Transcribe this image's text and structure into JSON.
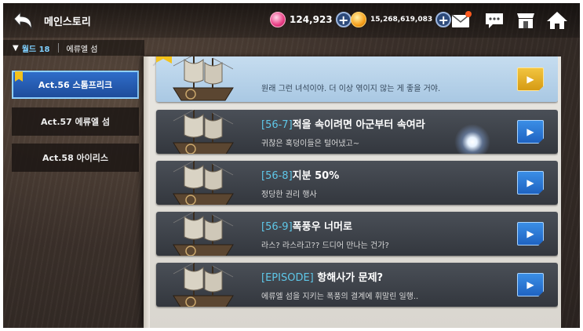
{
  "header": {
    "title": "메인스토리",
    "currency_gem": "124,923",
    "currency_gold": "15,268,619,083"
  },
  "breadcrumb": {
    "world": "월드 18",
    "island": "에류엘 섬"
  },
  "acts": [
    {
      "label": "Act.56 스톰프리크",
      "selected": true
    },
    {
      "label": "Act.57 에류엘 섬",
      "selected": false
    },
    {
      "label": "Act.58 아이리스",
      "selected": false
    }
  ],
  "chapters": [
    {
      "code": "",
      "title": "",
      "desc": "원래 그런 녀석이야. 더 이상 엮이지 않는 게 좋을 거야.",
      "state": "cleared"
    },
    {
      "code": "[56-7]",
      "title": "적을 속이려면 아군부터 속여라",
      "desc": "귀찮은 혹덩이들은 털어냈고~",
      "state": "open"
    },
    {
      "code": "[56-8]",
      "title": "지분 50%",
      "desc": "정당한 권리 행사",
      "state": "open"
    },
    {
      "code": "[56-9]",
      "title": "폭풍우 너머로",
      "desc": "라스? 라스라고?? 드디어 만나는 건가?",
      "state": "open"
    },
    {
      "code": "[EPISODE]",
      "title": " 항해사가 문제?",
      "desc": "에류엘 섬을 지키는 폭풍의 결계에 휘말린 일행..",
      "state": "open"
    }
  ],
  "colors": {
    "accent": "#2f6dc9",
    "code": "#5ec7e8",
    "gold": "#f3c21b"
  }
}
